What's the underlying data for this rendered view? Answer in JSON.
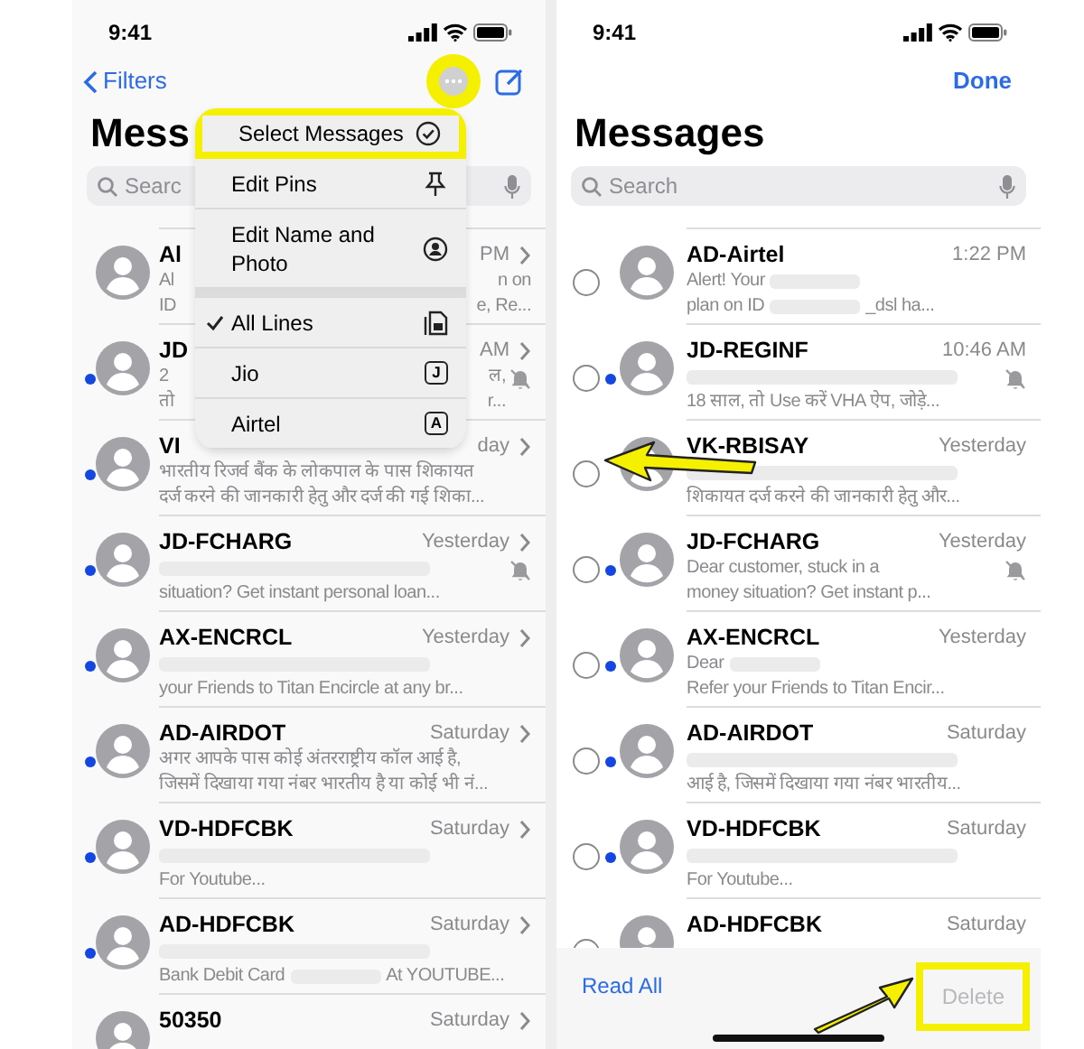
{
  "left_screen": {
    "status_bar": {
      "time": "9:41"
    },
    "nav": {
      "back_label": "Filters",
      "more_highlighted": true
    },
    "title": "Mess",
    "search": {
      "placeholder": "Searc"
    },
    "rows": [
      {
        "name": "Al",
        "time": "PM",
        "unread": false,
        "muted": false,
        "preview": [
          [
            {
              "kind": "text",
              "text": "Al"
            }
          ],
          [
            {
              "kind": "text",
              "text": "ID"
            }
          ]
        ],
        "tail": [
          "n on",
          "e, Re..."
        ]
      },
      {
        "name": "JD",
        "time": "AM",
        "unread": true,
        "muted": true,
        "preview": [
          [
            {
              "kind": "text",
              "text": "2"
            }
          ],
          [
            {
              "kind": "text",
              "text": "तो"
            }
          ]
        ],
        "tail": [
          "ल,",
          "r..."
        ]
      },
      {
        "name": "VI",
        "time": "day",
        "unread": true,
        "muted": false,
        "preview": [
          [
            {
              "kind": "text",
              "text": "भारतीय रिजर्व बैंक के लोकपाल के पास शिकायत"
            }
          ],
          [
            {
              "kind": "text",
              "text": "दर्ज करने की जानकारी हेतु और दर्ज की गई शिका..."
            }
          ]
        ]
      },
      {
        "name": "JD-FCHARG",
        "time": "Yesterday",
        "unread": true,
        "muted": true,
        "preview": [
          [
            {
              "kind": "redaction"
            }
          ],
          [
            {
              "kind": "text",
              "text": "situation? Get instant personal loan..."
            }
          ]
        ]
      },
      {
        "name": "AX-ENCRCL",
        "time": "Yesterday",
        "unread": true,
        "muted": false,
        "preview": [
          [
            {
              "kind": "redaction"
            }
          ],
          [
            {
              "kind": "text",
              "text": "your Friends to Titan Encircle at any br..."
            }
          ]
        ]
      },
      {
        "name": "AD-AIRDOT",
        "time": "Saturday",
        "unread": true,
        "muted": false,
        "preview": [
          [
            {
              "kind": "text",
              "text": "अगर आपके पास कोई अंतरराष्ट्रीय कॉल आई है,"
            }
          ],
          [
            {
              "kind": "text",
              "text": "जिसमें दिखाया गया नंबर भारतीय है या कोई भी नं..."
            }
          ]
        ]
      },
      {
        "name": "VD-HDFCBK",
        "time": "Saturday",
        "unread": true,
        "muted": false,
        "preview": [
          [
            {
              "kind": "redaction"
            }
          ],
          [
            {
              "kind": "text",
              "text": "For Youtube..."
            }
          ]
        ]
      },
      {
        "name": "AD-HDFCBK",
        "time": "Saturday",
        "unread": true,
        "muted": false,
        "preview": [
          [
            {
              "kind": "redaction"
            }
          ],
          [
            {
              "kind": "text",
              "text": "Bank Debit Card"
            },
            {
              "kind": "redaction"
            },
            {
              "kind": "text",
              "text": "At YOUTUBE..."
            }
          ]
        ]
      },
      {
        "name": "50350",
        "time": "Saturday",
        "unread": false,
        "muted": false,
        "preview": []
      }
    ],
    "menu": {
      "actions": [
        {
          "label": "Select Messages",
          "highlighted": true
        },
        {
          "label": "Edit Pins",
          "highlighted": false
        },
        {
          "label": "Edit Name and Photo",
          "highlighted": false
        }
      ],
      "lines": [
        {
          "kind": "all",
          "label": "All Lines",
          "checked": true
        },
        {
          "kind": "line",
          "label": "Jio",
          "checked": false,
          "badge": "J"
        },
        {
          "kind": "line",
          "label": "Airtel",
          "checked": false,
          "badge": "A"
        }
      ]
    }
  },
  "right_screen": {
    "status_bar": {
      "time": "9:41"
    },
    "nav": {
      "done_label": "Done"
    },
    "title": "Messages",
    "search": {
      "placeholder": "Search"
    },
    "rows": [
      {
        "name": "AD-Airtel",
        "time": "1:22 PM",
        "unread": false,
        "muted": false,
        "selected": false,
        "pointed": false,
        "preview": [
          [
            {
              "kind": "text",
              "text": "Alert! Your"
            },
            {
              "kind": "redaction"
            }
          ],
          [
            {
              "kind": "text",
              "text": "plan on ID"
            },
            {
              "kind": "redaction"
            },
            {
              "kind": "text",
              "text": "_dsl ha..."
            }
          ]
        ]
      },
      {
        "name": "JD-REGINF",
        "time": "10:46 AM",
        "unread": true,
        "muted": true,
        "selected": false,
        "pointed": false,
        "preview": [
          [
            {
              "kind": "redaction"
            }
          ],
          [
            {
              "kind": "text",
              "text": "18 साल, तो Use करें VHA ऐप, जोड़े..."
            }
          ]
        ]
      },
      {
        "name": "VK-RBISAY",
        "time": "Yesterday",
        "unread": false,
        "muted": false,
        "selected": false,
        "pointed": true,
        "preview": [
          [
            {
              "kind": "redaction"
            }
          ],
          [
            {
              "kind": "text",
              "text": "शिकायत दर्ज करने की जानकारी हेतु और..."
            }
          ]
        ]
      },
      {
        "name": "JD-FCHARG",
        "time": "Yesterday",
        "unread": true,
        "muted": true,
        "selected": false,
        "pointed": false,
        "preview": [
          [
            {
              "kind": "text",
              "text": "Dear customer, stuck in a"
            }
          ],
          [
            {
              "kind": "text",
              "text": "money situation? Get instant p..."
            }
          ]
        ]
      },
      {
        "name": "AX-ENCRCL",
        "time": "Yesterday",
        "unread": true,
        "muted": false,
        "selected": false,
        "pointed": false,
        "preview": [
          [
            {
              "kind": "text",
              "text": "Dear"
            },
            {
              "kind": "redaction"
            }
          ],
          [
            {
              "kind": "text",
              "text": "Refer your Friends to Titan Encir..."
            }
          ]
        ]
      },
      {
        "name": "AD-AIRDOT",
        "time": "Saturday",
        "unread": true,
        "muted": false,
        "selected": false,
        "pointed": false,
        "preview": [
          [
            {
              "kind": "redaction"
            }
          ],
          [
            {
              "kind": "text",
              "text": "आई है, जिसमें दिखाया गया नंबर भारतीय..."
            }
          ]
        ]
      },
      {
        "name": "VD-HDFCBK",
        "time": "Saturday",
        "unread": true,
        "muted": false,
        "selected": false,
        "pointed": false,
        "preview": [
          [
            {
              "kind": "redaction"
            }
          ],
          [
            {
              "kind": "text",
              "text": "For Youtube..."
            }
          ]
        ]
      },
      {
        "name": "AD-HDFCBK",
        "time": "Saturday",
        "unread": false,
        "muted": false,
        "selected": false,
        "pointed": false,
        "preview": []
      }
    ],
    "toolbar": {
      "read_all": "Read All",
      "delete": {
        "label": "Delete",
        "disabled": true,
        "highlighted": true,
        "pointed": true
      }
    }
  }
}
